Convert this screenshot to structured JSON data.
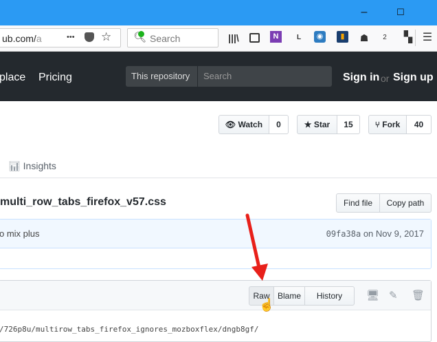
{
  "browser": {
    "window_controls": {
      "minimize": "–",
      "maximize": "☐"
    },
    "url_partial": "ub.com/",
    "url_faded": "a",
    "url_more": "•••",
    "search_placeholder": "Search",
    "toolbar_icons": [
      "library-icon",
      "sidebar-icon",
      "onenote-icon",
      "lastpass-icon",
      "feed-icon",
      "stats-icon",
      "ghostery-icon",
      "notification-icon",
      "extensions-icon",
      "menu-icon"
    ],
    "lastpass_letter": "L",
    "notification_count": "2"
  },
  "github_header": {
    "nav": [
      "place",
      "Pricing"
    ],
    "scope_label": "This repository",
    "search_placeholder": "Search",
    "sign_in": "Sign in",
    "or": "or",
    "sign_up": "Sign up"
  },
  "repo": {
    "watch_label": "Watch",
    "watch_count": "0",
    "star_label": "Star",
    "star_count": "15",
    "fork_label": "Fork",
    "fork_count": "40",
    "insights_tab": "Insights"
  },
  "file": {
    "name": "multi_row_tabs_firefox_v57.css",
    "find_file": "Find file",
    "copy_path": "Copy path",
    "commit_message": "o mix plus",
    "commit_sha": "09fa38a",
    "commit_date": "on Nov 9, 2017",
    "raw": "Raw",
    "blame": "Blame",
    "history": "History",
    "code_line": "/726p8u/multirow_tabs_firefox_ignores_mozboxflex/dngb8gf/"
  },
  "colors": {
    "titlebar": "#2b9af3",
    "github_header": "#24292e",
    "arrow": "#e8201a"
  }
}
